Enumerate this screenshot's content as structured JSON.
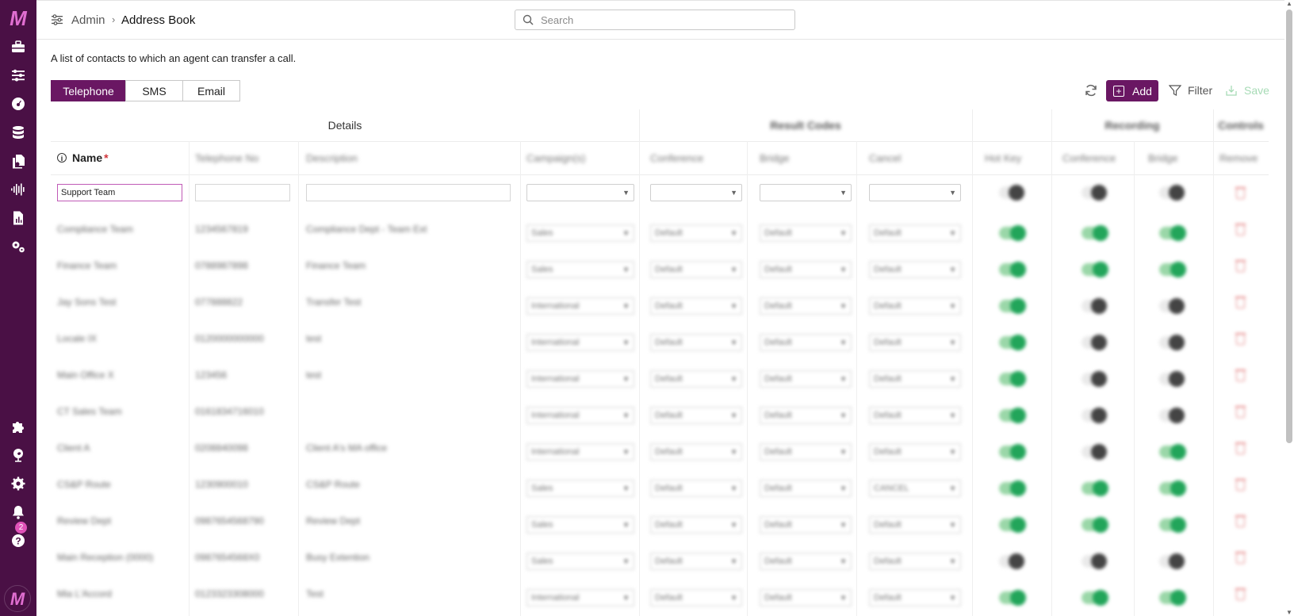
{
  "sidebar": {
    "logo": "M",
    "icons": [
      "toolbox-icon",
      "sliders-icon",
      "dashboard-gauge-icon",
      "database-icon",
      "documents-icon",
      "audio-waveform-icon",
      "report-icon",
      "cogs-icon",
      "puzzle-icon",
      "globe-icon",
      "settings-gear-icon",
      "bell-icon",
      "help-icon"
    ],
    "notification_count": "2",
    "bottom_logo": "M"
  },
  "header": {
    "breadcrumb_parent": "Admin",
    "breadcrumb_sep": "›",
    "breadcrumb_current": "Address Book",
    "search_placeholder": "Search"
  },
  "page": {
    "description": "A list of contacts to which an agent can transfer a call.",
    "tabs": [
      {
        "label": "Telephone",
        "active": true
      },
      {
        "label": "SMS",
        "active": false
      },
      {
        "label": "Email",
        "active": false
      }
    ],
    "actions": {
      "add": "Add",
      "filter": "Filter",
      "save": "Save"
    }
  },
  "table": {
    "groups": {
      "details": "Details",
      "result_codes": "Result Codes",
      "recording": "Recording",
      "controls": "Controls"
    },
    "columns": {
      "name": "Name",
      "telephone": "Telephone No",
      "description": "Description",
      "campaigns": "Campaign(s)",
      "conference": "Conference",
      "bridge": "Bridge",
      "cancel": "Cancel",
      "hot_key": "Hot Key",
      "rec_conference": "Conference",
      "rec_bridge": "Bridge",
      "remove": "Remove"
    },
    "new_row_name": "Support Team",
    "rows": [
      {
        "name": "Compliance Team",
        "tel": "1234567819",
        "desc": "Compliance Dept - Team Ext",
        "campaign": "Sales",
        "conf": "Default",
        "bridge": "Default",
        "cancel": "Default",
        "hot": true,
        "rconf": true,
        "rbridge": true
      },
      {
        "name": "Finance Team",
        "tel": "0788987898",
        "desc": "Finance Team",
        "campaign": "Sales",
        "conf": "Default",
        "bridge": "Default",
        "cancel": "Default",
        "hot": true,
        "rconf": true,
        "rbridge": true
      },
      {
        "name": "Jay Sons Test",
        "tel": "077888822",
        "desc": "Transfer Test",
        "campaign": "International",
        "conf": "Default",
        "bridge": "Default",
        "cancel": "Default",
        "hot": true,
        "rconf": false,
        "rbridge": false
      },
      {
        "name": "Locale IX",
        "tel": "0120000000000",
        "desc": "test",
        "campaign": "International",
        "conf": "Default",
        "bridge": "Default",
        "cancel": "Default",
        "hot": true,
        "rconf": false,
        "rbridge": false
      },
      {
        "name": "Main Office X",
        "tel": "123456",
        "desc": "test",
        "campaign": "International",
        "conf": "Default",
        "bridge": "Default",
        "cancel": "Default",
        "hot": true,
        "rconf": false,
        "rbridge": false
      },
      {
        "name": "CT Sales Team",
        "tel": "0161834716010",
        "desc": "",
        "campaign": "International",
        "conf": "Default",
        "bridge": "Default",
        "cancel": "Default",
        "hot": true,
        "rconf": false,
        "rbridge": false
      },
      {
        "name": "Client A",
        "tel": "0208840098",
        "desc": "Client A's MA office",
        "campaign": "International",
        "conf": "Default",
        "bridge": "Default",
        "cancel": "Default",
        "hot": true,
        "rconf": false,
        "rbridge": true
      },
      {
        "name": "CS&P Route",
        "tel": "1230900010",
        "desc": "CS&P Route",
        "campaign": "Sales",
        "conf": "Default",
        "bridge": "Default",
        "cancel": "CANCEL",
        "hot": true,
        "rconf": true,
        "rbridge": true
      },
      {
        "name": "Review Dept",
        "tel": "0987654568790",
        "desc": "Review Dept",
        "campaign": "Sales",
        "conf": "Default",
        "bridge": "Default",
        "cancel": "Default",
        "hot": true,
        "rconf": true,
        "rbridge": true
      },
      {
        "name": "Main Reception (0000)",
        "tel": "0987654568X0",
        "desc": "Busy Extention",
        "campaign": "Sales",
        "conf": "Default",
        "bridge": "Default",
        "cancel": "Default",
        "hot": false,
        "rconf": false,
        "rbridge": false
      },
      {
        "name": "Mia L'Accord",
        "tel": "0123323308000",
        "desc": "Test",
        "campaign": "International",
        "conf": "Default",
        "bridge": "Default",
        "cancel": "Default",
        "hot": true,
        "rconf": true,
        "rbridge": true
      }
    ]
  }
}
